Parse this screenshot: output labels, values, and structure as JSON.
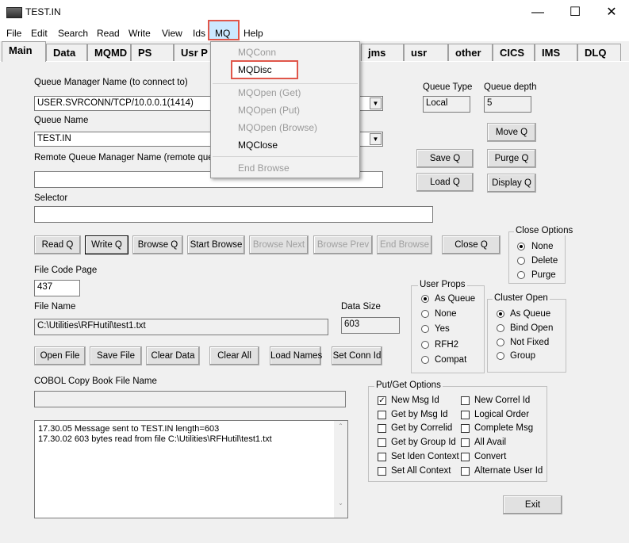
{
  "window": {
    "title": "TEST.IN",
    "minimize": "—",
    "maximize": "☐",
    "close": "✕"
  },
  "menu": [
    "File",
    "Edit",
    "Search",
    "Read",
    "Write",
    "View",
    "Ids",
    "MQ",
    "Help"
  ],
  "tabs": [
    "Main",
    "Data",
    "MQMD",
    "PS",
    "Usr P",
    "jms",
    "usr",
    "other",
    "CICS",
    "IMS",
    "DLQ"
  ],
  "mq_menu": {
    "items": [
      {
        "label": "MQConn",
        "enabled": false
      },
      {
        "label": "MQDisc",
        "enabled": true
      },
      {
        "label": "MQOpen (Get)",
        "enabled": false
      },
      {
        "label": "MQOpen (Put)",
        "enabled": false
      },
      {
        "label": "MQOpen (Browse)",
        "enabled": false
      },
      {
        "label": "MQClose",
        "enabled": true
      },
      {
        "label": "End Browse",
        "enabled": false
      }
    ]
  },
  "main": {
    "qmgr_label": "Queue Manager Name (to connect to)",
    "qmgr_value": "USER.SVRCONN/TCP/10.0.0.1(1414)",
    "queue_label": "Queue Name",
    "queue_value": "TEST.IN",
    "remote_label": "Remote Queue Manager Name (remote queues",
    "remote_value": "",
    "selector_label": "Selector",
    "selector_value": "",
    "queue_type_label": "Queue Type",
    "queue_type_value": "Local",
    "queue_depth_label": "Queue depth",
    "queue_depth_value": "5",
    "file_code_page_label": "File Code Page",
    "file_code_page_value": "437",
    "file_name_label": "File Name",
    "file_name_value": "C:\\Utilities\\RFHutil\\test1.txt",
    "data_size_label": "Data Size",
    "data_size_value": "603",
    "cobol_label": "COBOL Copy Book File Name",
    "cobol_value": ""
  },
  "buttons": {
    "move_q": "Move Q",
    "save_q": "Save Q",
    "purge_q": "Purge Q",
    "load_q": "Load Q",
    "display_q": "Display Q",
    "read_q": "Read Q",
    "write_q": "Write Q",
    "browse_q": "Browse Q",
    "start_browse": "Start Browse",
    "browse_next": "Browse Next",
    "browse_prev": "Browse Prev",
    "end_browse": "End Browse",
    "close_q": "Close Q",
    "open_file": "Open File",
    "save_file": "Save File",
    "clear_data": "Clear Data",
    "clear_all": "Clear All",
    "load_names": "Load Names",
    "set_conn_id": "Set Conn Id",
    "exit": "Exit"
  },
  "close_options": {
    "title": "Close Options",
    "options": [
      "None",
      "Delete",
      "Purge"
    ],
    "selected": 0
  },
  "user_props": {
    "title": "User Props",
    "options": [
      "As Queue",
      "None",
      "Yes",
      "RFH2",
      "Compat"
    ],
    "selected": 0
  },
  "cluster_open": {
    "title": "Cluster Open",
    "options": [
      "As Queue",
      "Bind Open",
      "Not Fixed",
      "Group"
    ],
    "selected": 0
  },
  "put_get": {
    "title": "Put/Get Options",
    "left": [
      {
        "label": "New Msg Id",
        "checked": true
      },
      {
        "label": "Get by Msg Id",
        "checked": false
      },
      {
        "label": "Get by Correlid",
        "checked": false
      },
      {
        "label": "Get by Group Id",
        "checked": false
      },
      {
        "label": "Set Iden Context",
        "checked": false
      },
      {
        "label": "Set All Context",
        "checked": false
      }
    ],
    "right": [
      {
        "label": "New Correl Id",
        "checked": false
      },
      {
        "label": "Logical Order",
        "checked": false
      },
      {
        "label": "Complete Msg",
        "checked": false
      },
      {
        "label": "All Avail",
        "checked": false
      },
      {
        "label": "Convert",
        "checked": false
      },
      {
        "label": "Alternate User Id",
        "checked": false
      }
    ]
  },
  "log": {
    "lines": [
      "17.30.05 Message sent to TEST.IN length=603",
      "17.30.02 603 bytes read from file C:\\Utilities\\RFHutil\\test1.txt"
    ]
  },
  "colors": {
    "highlight": "#e0564a",
    "menu_hover": "#cce8ff"
  }
}
